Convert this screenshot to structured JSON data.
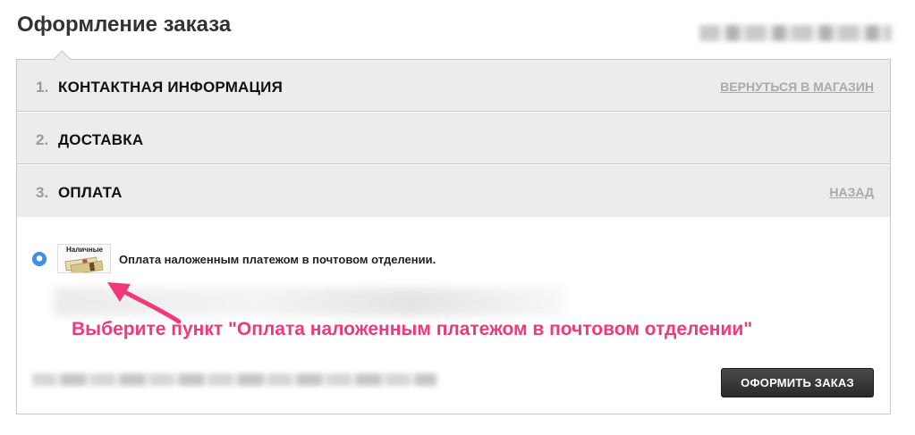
{
  "header": {
    "page_title": "Оформление заказа"
  },
  "steps": [
    {
      "number": "1.",
      "title": "КОНТАКТНАЯ ИНФОРМАЦИЯ",
      "link": "ВЕРНУТЬСЯ В МАГАЗИН"
    },
    {
      "number": "2.",
      "title": "ДОСТАВКА"
    },
    {
      "number": "3.",
      "title": "ОПЛАТА",
      "link": "НАЗАД"
    }
  ],
  "payment": {
    "icon_label": "Наличные",
    "option_label": "Оплата наложенным платежом в почтовом отделении.",
    "selected": true,
    "icon_name": "cash-icon"
  },
  "annotation": {
    "text": "Выберите пункт \"Оплата наложенным платежом в почтовом отделении\"",
    "color": "#f0387a"
  },
  "actions": {
    "submit_label": "ОФОРМИТЬ ЗАКАЗ"
  },
  "colors": {
    "step_background": "#ececec",
    "radio_selected": "#3b8ff0",
    "button_background": "#333333"
  }
}
